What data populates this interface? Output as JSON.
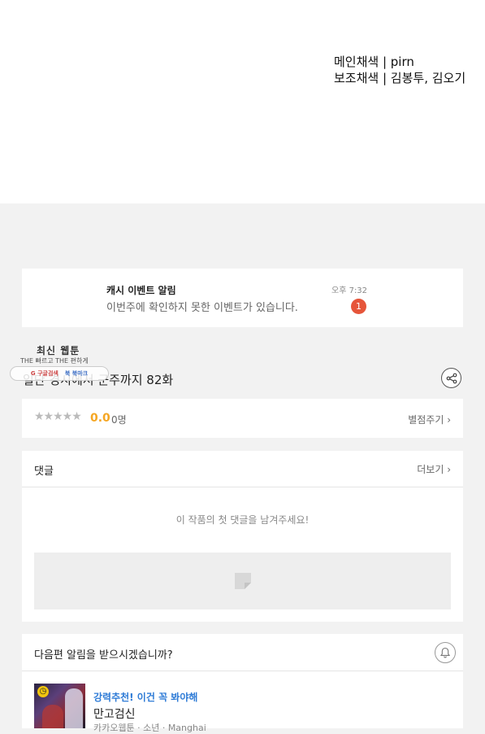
{
  "credits": {
    "line1": "메인채색 | pirn",
    "line2": "보조채색 | 김봉투, 김오기"
  },
  "notification": {
    "title": "캐시 이벤트 알림",
    "message": "이번주에 확인하지 못한 이벤트가 있습니다.",
    "time": "오후 7:32",
    "badge": "1"
  },
  "logo": {
    "title": "최신 웹툰",
    "slogan": "THE 빠르고 THE 편하게",
    "btn_google": "G 구글검색",
    "btn_bookmark": "북 북마크"
  },
  "episode": {
    "title": "일단 경시에서 군주까지 82화"
  },
  "rating": {
    "stars": "★★★★★",
    "score": "0.0",
    "count": "0명",
    "rate_link": "별점주기 ›"
  },
  "comments": {
    "label": "댓글",
    "more": "더보기 ›",
    "empty": "이 작품의 첫 댓글을 남겨주세요!"
  },
  "alert": {
    "question": "다음편 알림을 받으시겠습니까?"
  },
  "recommend": {
    "tag": "강력추천! 이건 꼭 봐야해",
    "title": "만고검신",
    "meta": "카카오웹툰 · 소년 · Manghai"
  },
  "colors": {
    "badge_red": "#e6553a",
    "score_orange": "#f5a623",
    "link_blue": "#2e7bd6",
    "background_gray": "#f2f2f2"
  }
}
